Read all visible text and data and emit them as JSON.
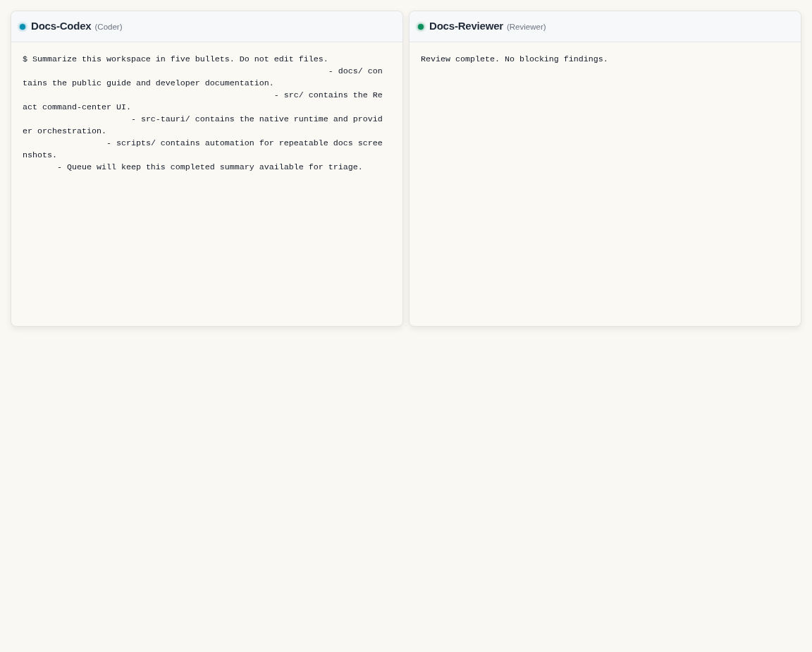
{
  "panes": [
    {
      "name": "Docs-Codex",
      "role": "(Coder)",
      "color": "#0b8fb3",
      "output": [
        "$ Summarize this workspace in five bullets. Do not edit files.",
        "- docs/ contains the public guide and developer documentation.",
        "- src/ contains the React command-center UI.",
        "- src-tauri/ contains the native runtime and provider orchestration.",
        "- scripts/ contains automation for repeatable docs screenshots.",
        "- Queue will keep this completed summary available for triage."
      ]
    },
    {
      "name": "Docs-Reviewer",
      "role": "(Reviewer)",
      "color": "#0a8f5c",
      "output": [
        "Review complete. No blocking findings."
      ]
    }
  ]
}
